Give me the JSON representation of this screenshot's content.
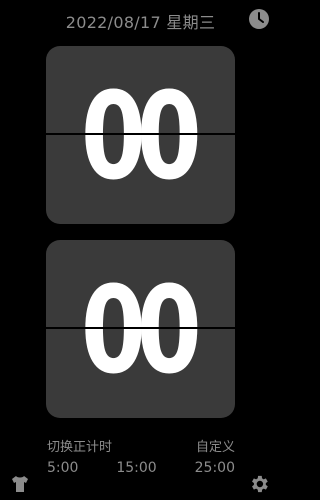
{
  "header": {
    "date": "2022/08/17 星期三"
  },
  "clock": {
    "top_digits": "00",
    "bottom_digits": "00"
  },
  "controls": {
    "switch_label": "切换正计时",
    "custom_label": "自定义"
  },
  "presets": [
    "5:00",
    "15:00",
    "25:00"
  ],
  "icons": {
    "clock": "clock-icon",
    "shirt": "shirt-icon",
    "gear": "gear-icon"
  }
}
